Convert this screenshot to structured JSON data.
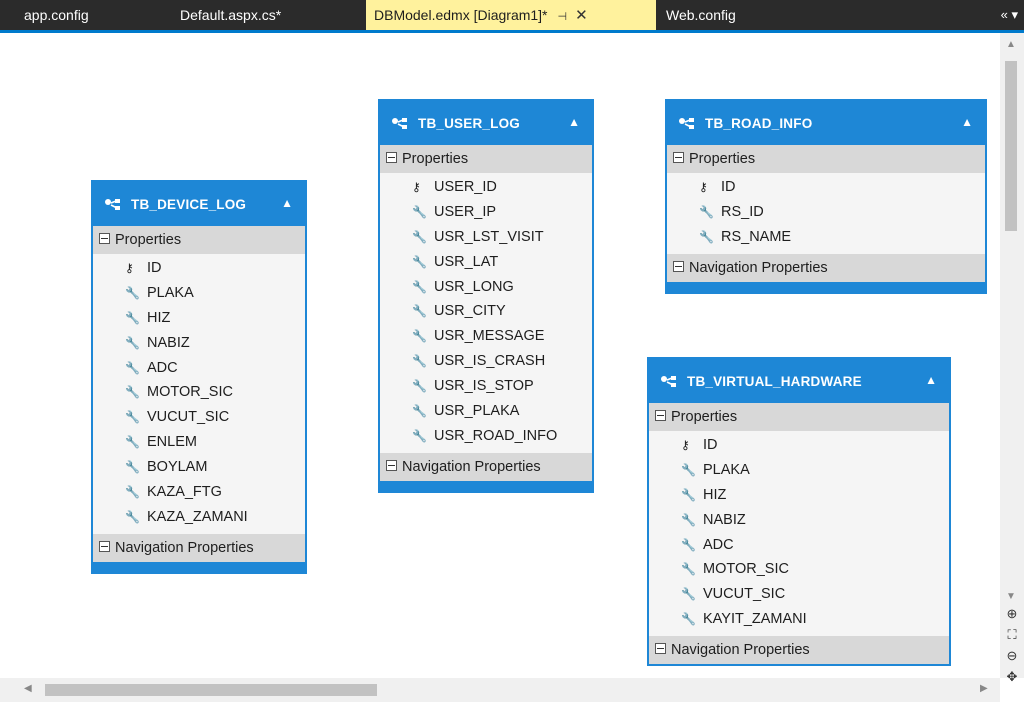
{
  "tabs": [
    {
      "label": "app.config"
    },
    {
      "label": "Default.aspx.cs*"
    },
    {
      "label": "DBModel.edmx [Diagram1]*",
      "active": true
    },
    {
      "label": "Web.config"
    }
  ],
  "tabstrip_overflow": "«",
  "section_labels": {
    "properties": "Properties",
    "navigation": "Navigation Properties"
  },
  "entities": {
    "device_log": {
      "name": "TB_DEVICE_LOG",
      "properties": [
        {
          "name": "ID",
          "icon": "key-icon"
        },
        {
          "name": "PLAKA",
          "icon": "wrench-icon"
        },
        {
          "name": "HIZ",
          "icon": "wrench-icon"
        },
        {
          "name": "NABIZ",
          "icon": "wrench-icon"
        },
        {
          "name": "ADC",
          "icon": "wrench-icon"
        },
        {
          "name": "MOTOR_SIC",
          "icon": "wrench-icon"
        },
        {
          "name": "VUCUT_SIC",
          "icon": "wrench-icon"
        },
        {
          "name": "ENLEM",
          "icon": "wrench-icon"
        },
        {
          "name": "BOYLAM",
          "icon": "wrench-icon"
        },
        {
          "name": "KAZA_FTG",
          "icon": "wrench-icon"
        },
        {
          "name": "KAZA_ZAMANI",
          "icon": "wrench-icon"
        }
      ]
    },
    "user_log": {
      "name": "TB_USER_LOG",
      "properties": [
        {
          "name": "USER_ID",
          "icon": "key-icon"
        },
        {
          "name": "USER_IP",
          "icon": "wrench-icon"
        },
        {
          "name": "USR_LST_VISIT",
          "icon": "wrench-icon"
        },
        {
          "name": "USR_LAT",
          "icon": "wrench-icon"
        },
        {
          "name": "USR_LONG",
          "icon": "wrench-icon"
        },
        {
          "name": "USR_CITY",
          "icon": "wrench-icon"
        },
        {
          "name": "USR_MESSAGE",
          "icon": "wrench-icon"
        },
        {
          "name": "USR_IS_CRASH",
          "icon": "wrench-icon"
        },
        {
          "name": "USR_IS_STOP",
          "icon": "wrench-icon"
        },
        {
          "name": "USR_PLAKA",
          "icon": "wrench-icon"
        },
        {
          "name": "USR_ROAD_INFO",
          "icon": "wrench-icon"
        }
      ]
    },
    "road_info": {
      "name": "TB_ROAD_INFO",
      "properties": [
        {
          "name": "ID",
          "icon": "key-icon"
        },
        {
          "name": "RS_ID",
          "icon": "wrench-icon"
        },
        {
          "name": "RS_NAME",
          "icon": "wrench-icon"
        }
      ]
    },
    "virtual_hardware": {
      "name": "TB_VIRTUAL_HARDWARE",
      "properties": [
        {
          "name": "ID",
          "icon": "key-icon"
        },
        {
          "name": "PLAKA",
          "icon": "wrench-icon"
        },
        {
          "name": "HIZ",
          "icon": "wrench-icon"
        },
        {
          "name": "NABIZ",
          "icon": "wrench-icon"
        },
        {
          "name": "ADC",
          "icon": "wrench-icon"
        },
        {
          "name": "MOTOR_SIC",
          "icon": "wrench-icon"
        },
        {
          "name": "VUCUT_SIC",
          "icon": "wrench-icon"
        },
        {
          "name": "KAYIT_ZAMANI",
          "icon": "wrench-icon"
        }
      ]
    }
  },
  "colors": {
    "entity_blue": "#1e87d6",
    "active_tab": "#fff29d",
    "tabstrip": "#2b2b2b"
  }
}
